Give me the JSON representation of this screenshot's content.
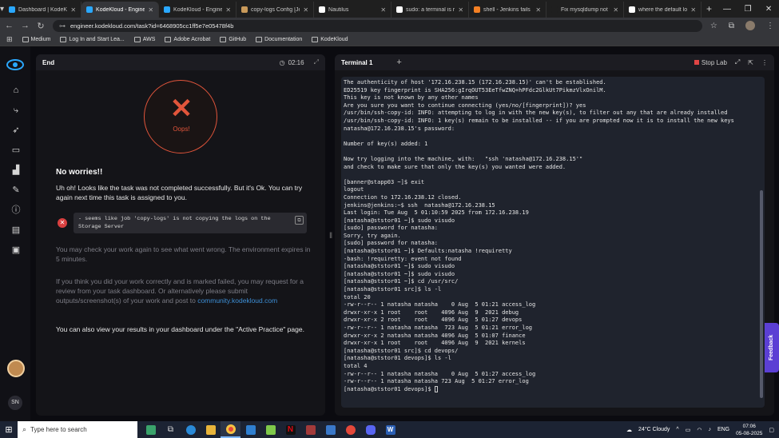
{
  "browser": {
    "tabs": [
      {
        "title": "Dashboard | KodeKlo",
        "color": "#2aa8ff",
        "active": false
      },
      {
        "title": "KodeKloud - Engineer",
        "color": "#2aa8ff",
        "active": true
      },
      {
        "title": "KodeKloud - Engineer",
        "color": "#2aa8ff",
        "active": false
      },
      {
        "title": "copy-logs Config [Je",
        "color": "#c99a5a",
        "active": false
      },
      {
        "title": "Nautilus",
        "color": "#ffffff",
        "active": false
      },
      {
        "title": "sudo: a terminal is re",
        "color": "#ffffff",
        "active": false
      },
      {
        "title": "shell - Jenkins fails a",
        "color": "#f48024",
        "active": false
      },
      {
        "title": "Fix mysqldump not f",
        "color": "#1f1f1f",
        "active": false
      },
      {
        "title": "where the default lo",
        "color": "#ffffff",
        "active": false
      }
    ],
    "url": "engineer.kodekloud.com/task?id=6468905cc1ff5e7e05478f4b",
    "bookmarks": [
      "Medium",
      "Log In and Start Lea...",
      "AWS",
      "Adobe Acrobat",
      "GitHub",
      "Documentation",
      "KodeKloud"
    ]
  },
  "left_panel": {
    "tab": "End",
    "timer": "02:16",
    "oops": "Oops!",
    "heading": "No worries!!",
    "message": "Uh oh! Looks like the task was not completed successfully. But it's Ok. You can try again next time this task is assigned to you.",
    "error": "- seems like job 'copy-logs' is not copying the logs on the Storage Server",
    "expire_note": "You may check your work again to see what went wrong. The environment expires in 5 minutes.",
    "review_note": "If you think you did your work correctly and is marked failed, you may request for a review from your task dashboard. Or alternatively please submit outputs/screenshot(s) of your work and post to",
    "community_link": "community.kodekloud.com",
    "dashboard_note": "You can also view your results in your dashboard under the \"Active Practice\" page."
  },
  "right_panel": {
    "tab": "Terminal 1",
    "stop_lab": "Stop Lab",
    "lines": [
      "The authenticity of host '172.16.238.15 (172.16.238.15)' can't be established.",
      "ED25519 key fingerprint is SHA256:gIrqOUT53EeTfwZNQ+hPFdc2GlkUt7PikmzVlxOnilM.",
      "This key is not known by any other names",
      "Are you sure you want to continue connecting (yes/no/[fingerprint])? yes",
      "/usr/bin/ssh-copy-id: INFO: attempting to log in with the new key(s), to filter out any that are already installed",
      "/usr/bin/ssh-copy-id: INFO: 1 key(s) remain to be installed -- if you are prompted now it is to install the new keys",
      "natasha@172.16.238.15's password:",
      "",
      "Number of key(s) added: 1",
      "",
      "Now try logging into the machine, with:   \"ssh 'natasha@172.16.238.15'\"",
      "and check to make sure that only the key(s) you wanted were added.",
      "",
      "[banner@stapp03 ~]$ exit",
      "logout",
      "Connection to 172.16.238.12 closed.",
      "jenkins@jenkins:~$ ssh  natasha@172.16.238.15",
      "Last login: Tue Aug  5 01:10:59 2025 from 172.16.238.19",
      "[natasha@ststor01 ~]$ sudo visudo",
      "[sudo] password for natasha:",
      "Sorry, try again.",
      "[sudo] password for natasha:",
      "[natasha@ststor01 ~]$ Defaults:natasha !requiretty",
      "-bash: !requiretty: event not found",
      "[natasha@ststor01 ~]$ sudo visudo",
      "[natasha@ststor01 ~]$ sudo visudo",
      "[natasha@ststor01 ~]$ cd /usr/src/",
      "[natasha@ststor01 src]$ ls -l",
      "total 20",
      "-rw-r--r-- 1 natasha natasha    0 Aug  5 01:21 access_log",
      "drwxr-xr-x 1 root    root    4096 Aug  9  2021 debug",
      "drwxr-xr-x 2 root    root    4096 Aug  5 01:27 devops",
      "-rw-r--r-- 1 natasha natasha  723 Aug  5 01:21 error_log",
      "drwxr-xr-x 2 natasha natasha 4096 Aug  5 01:07 finance",
      "drwxr-xr-x 1 root    root    4096 Aug  9  2021 kernels",
      "[natasha@ststor01 src]$ cd devops/",
      "[natasha@ststor01 devops]$ ls -l",
      "total 4",
      "-rw-r--r-- 1 natasha natasha    0 Aug  5 01:27 access_log",
      "-rw-r--r-- 1 natasha natasha 723 Aug  5 01:27 error_log",
      "[natasha@ststor01 devops]$ "
    ]
  },
  "feedback": "Feedback",
  "taskbar": {
    "search_placeholder": "Type here to search",
    "weather": "24°C  Cloudy",
    "lang": "ENG",
    "time": "07:06",
    "date": "05-08-2025"
  }
}
